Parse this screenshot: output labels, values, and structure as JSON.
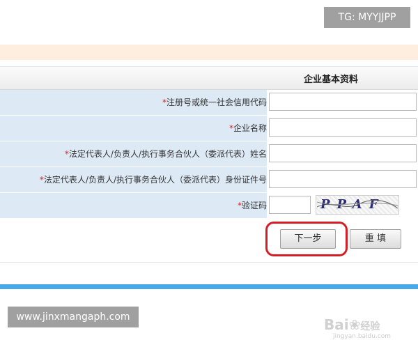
{
  "watermarks": {
    "top_right": "TG: MYYJJPP",
    "bottom_left": "www.jinxmangaph.com",
    "baidu": "Bai",
    "baidu_cn": "经验",
    "baidu_url": "jingyan.baidu.com"
  },
  "form": {
    "section_title": "企业基本资料",
    "required_mark": "*",
    "fields": [
      {
        "label": "注册号或统一社会信用代码",
        "value": ""
      },
      {
        "label": "企业名称",
        "value": ""
      },
      {
        "label": "法定代表人/负责人/执行事务合伙人（委派代表）姓名",
        "value": ""
      },
      {
        "label": "法定代表人/负责人/执行事务合伙人（委派代表）身份证件号",
        "value": ""
      }
    ],
    "captcha": {
      "label": "验证码",
      "value": "",
      "image_text": "PPAF"
    },
    "buttons": {
      "next": "下一步",
      "reset": "重 填"
    }
  },
  "colors": {
    "label_bg": "#dde9f5",
    "required": "#e02020",
    "highlight": "#d21e24",
    "accent_bar": "#4aa9e8",
    "top_band": "#fdeee0"
  },
  "icons": {
    "captcha": "captcha-image",
    "baidu": "paw-icon"
  }
}
